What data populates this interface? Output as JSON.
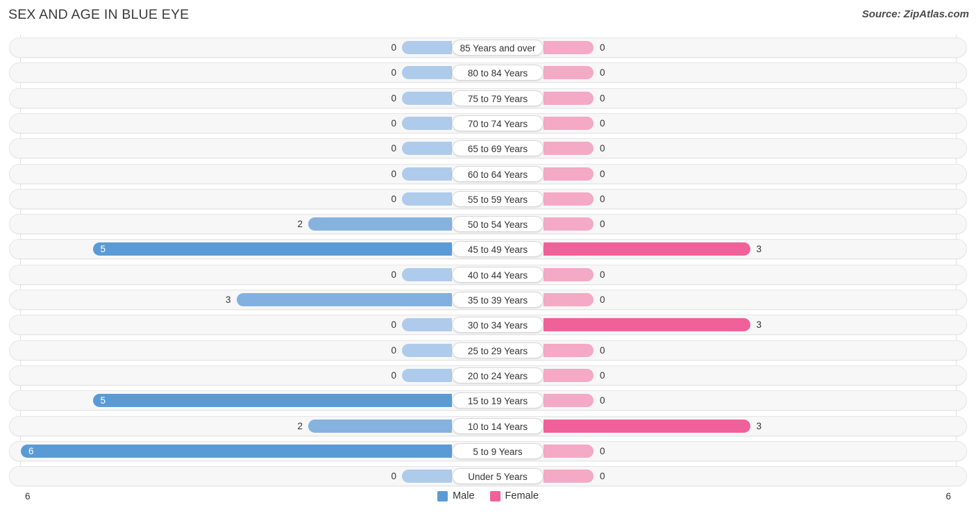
{
  "header": {
    "title": "SEX AND AGE IN BLUE EYE",
    "source": "Source: ZipAtlas.com"
  },
  "legend": {
    "male_label": "Male",
    "female_label": "Female",
    "male_color": "#5b9bd5",
    "female_color": "#f0619a"
  },
  "axis": {
    "left_max_label": "6",
    "right_max_label": "6"
  },
  "chart_data": {
    "type": "bar",
    "title": "SEX AND AGE IN BLUE EYE",
    "subtitle": "Source: ZipAtlas.com",
    "orientation": "horizontal-diverging",
    "xlabel": "",
    "ylabel": "",
    "xlim": [
      6,
      6
    ],
    "grid": true,
    "legend_position": "bottom-center",
    "categories": [
      "85 Years and over",
      "80 to 84 Years",
      "75 to 79 Years",
      "70 to 74 Years",
      "65 to 69 Years",
      "60 to 64 Years",
      "55 to 59 Years",
      "50 to 54 Years",
      "45 to 49 Years",
      "40 to 44 Years",
      "35 to 39 Years",
      "30 to 34 Years",
      "25 to 29 Years",
      "20 to 24 Years",
      "15 to 19 Years",
      "10 to 14 Years",
      "5 to 9 Years",
      "Under 5 Years"
    ],
    "series": [
      {
        "name": "Male",
        "color": "#5b9bd5",
        "values": [
          0,
          0,
          0,
          0,
          0,
          0,
          0,
          2,
          5,
          0,
          3,
          0,
          0,
          0,
          5,
          2,
          6,
          0
        ]
      },
      {
        "name": "Female",
        "color": "#f0619a",
        "values": [
          0,
          0,
          0,
          0,
          0,
          0,
          0,
          0,
          3,
          0,
          0,
          3,
          0,
          0,
          0,
          3,
          0,
          0
        ]
      }
    ]
  },
  "rows": [
    {
      "age": "85 Years and over",
      "male": "0",
      "female": "0"
    },
    {
      "age": "80 to 84 Years",
      "male": "0",
      "female": "0"
    },
    {
      "age": "75 to 79 Years",
      "male": "0",
      "female": "0"
    },
    {
      "age": "70 to 74 Years",
      "male": "0",
      "female": "0"
    },
    {
      "age": "65 to 69 Years",
      "male": "0",
      "female": "0"
    },
    {
      "age": "60 to 64 Years",
      "male": "0",
      "female": "0"
    },
    {
      "age": "55 to 59 Years",
      "male": "0",
      "female": "0"
    },
    {
      "age": "50 to 54 Years",
      "male": "2",
      "female": "0"
    },
    {
      "age": "45 to 49 Years",
      "male": "5",
      "female": "3"
    },
    {
      "age": "40 to 44 Years",
      "male": "0",
      "female": "0"
    },
    {
      "age": "35 to 39 Years",
      "male": "3",
      "female": "0"
    },
    {
      "age": "30 to 34 Years",
      "male": "0",
      "female": "3"
    },
    {
      "age": "25 to 29 Years",
      "male": "0",
      "female": "0"
    },
    {
      "age": "20 to 24 Years",
      "male": "0",
      "female": "0"
    },
    {
      "age": "15 to 19 Years",
      "male": "5",
      "female": "0"
    },
    {
      "age": "10 to 14 Years",
      "male": "2",
      "female": "3"
    },
    {
      "age": "5 to 9 Years",
      "male": "6",
      "female": "0"
    },
    {
      "age": "Under 5 Years",
      "male": "0",
      "female": "0"
    }
  ]
}
